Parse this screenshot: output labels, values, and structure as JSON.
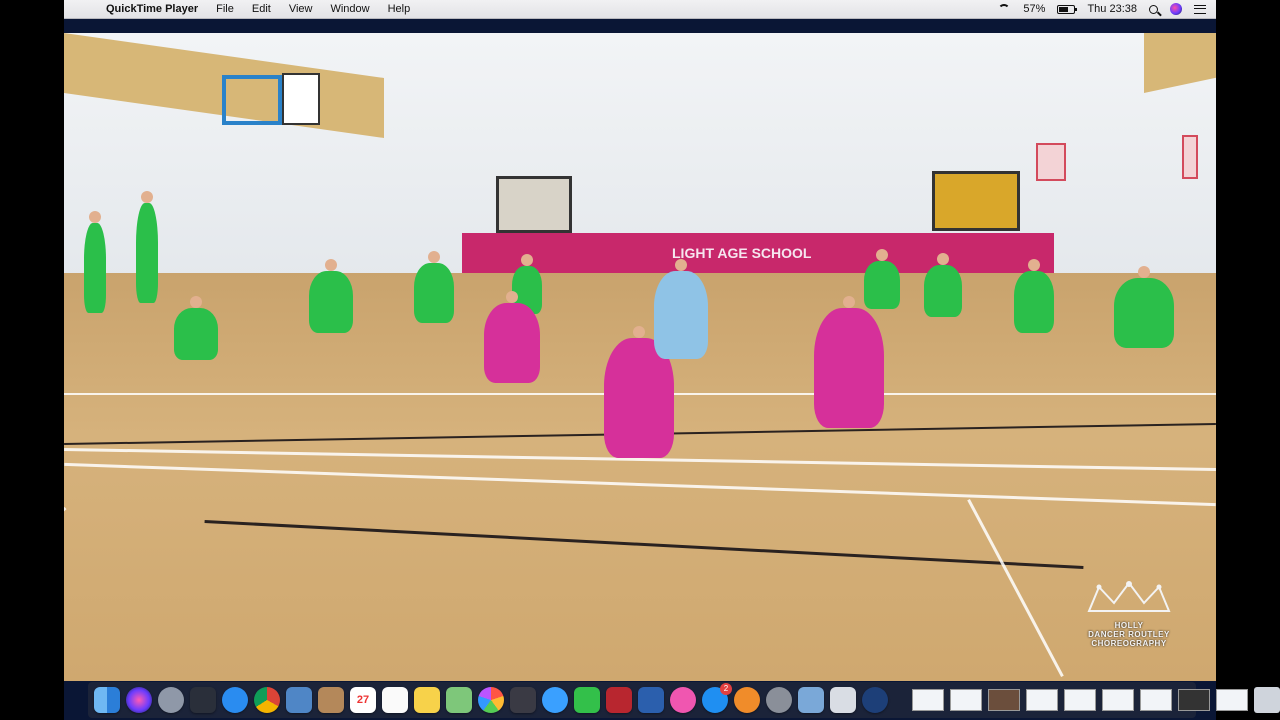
{
  "menubar": {
    "app": "QuickTime Player",
    "menus": [
      "File",
      "Edit",
      "View",
      "Window",
      "Help"
    ],
    "battery": "57%",
    "clock": "Thu 23:38"
  },
  "video": {
    "banner_text": "LIGHT  AGE  SCHOOL",
    "watermark": {
      "line1": "HOLLY",
      "line2": "DANCER ROUTLEY",
      "line3": "CHOREOGRAPHY"
    }
  },
  "dock": {
    "calendar_day": "27",
    "badge_count": "2",
    "icons": [
      "finder-icon",
      "siri-icon",
      "launchpad-icon",
      "dashboard-icon",
      "safari-icon",
      "chrome-icon",
      "preview-icon",
      "contacts-icon",
      "calendar-icon",
      "reminders-icon",
      "notes-icon",
      "maps-icon",
      "photos-icon",
      "photobooth-icon",
      "messages-icon",
      "facetime-icon",
      "photo-booth-icon",
      "word-icon",
      "itunes-icon",
      "appstore-icon",
      "ibooks-icon",
      "system-preferences-icon",
      "image-capture-icon",
      "quicktime-icon",
      "screen-sharing-icon"
    ]
  },
  "colors": {
    "menubar_bg": "#ececee",
    "desktop_bg": "#0a1635",
    "mat": "#c8286b",
    "floor": "#d6b27c",
    "green_costume": "#2bbf4a",
    "pink_costume": "#d6309a"
  }
}
